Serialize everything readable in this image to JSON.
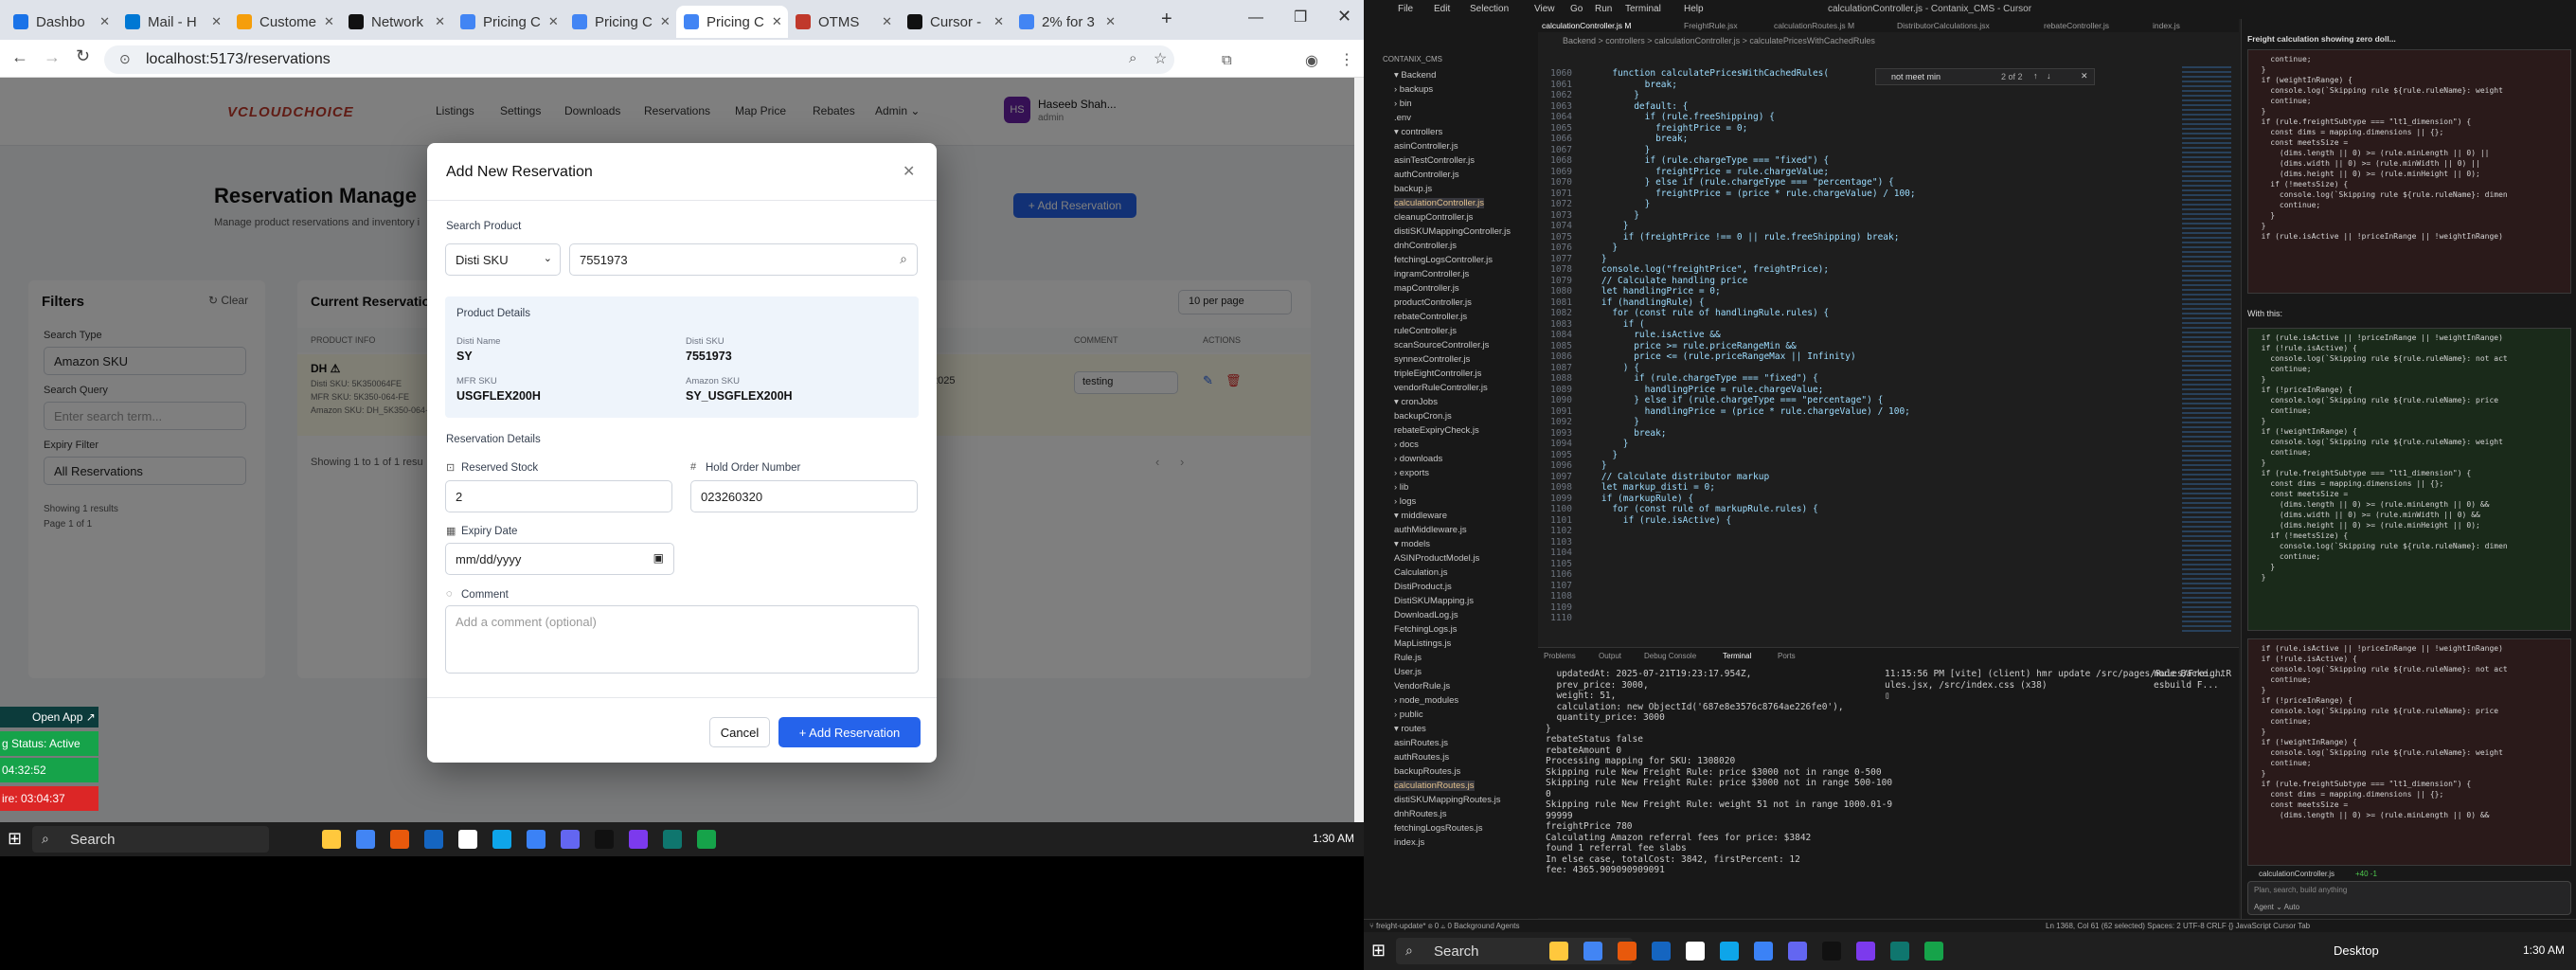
{
  "browser": {
    "tabs": [
      {
        "label": "Dashbo",
        "color": "#1a73e8",
        "active": false
      },
      {
        "label": "Mail - H",
        "color": "#0078d4",
        "active": false
      },
      {
        "label": "Custome",
        "color": "#f59e0b",
        "active": false
      },
      {
        "label": "Network",
        "color": "#111111",
        "active": false
      },
      {
        "label": "Pricing C",
        "color": "#4285f4",
        "active": false
      },
      {
        "label": "Pricing C",
        "color": "#4285f4",
        "active": false
      },
      {
        "label": "Pricing C",
        "color": "#4285f4",
        "active": true
      },
      {
        "label": "OTMS",
        "color": "#c0392b",
        "active": false
      },
      {
        "label": "Cursor -",
        "color": "#111111",
        "active": false
      },
      {
        "label": "2% for 3",
        "color": "#4285f4",
        "active": false
      }
    ],
    "url": "localhost:5173/reservations"
  },
  "nav": {
    "logo": "VCLOUDCHOICE",
    "items": [
      "Listings",
      "Settings",
      "Downloads",
      "Reservations",
      "Map Price",
      "Rebates",
      "Admin ⌄"
    ],
    "user_initials": "HS",
    "user_name": "Haseeb Shah...",
    "user_role": "admin"
  },
  "page": {
    "title": "Reservation Manage",
    "subtitle": "Manage product reservations and inventory i",
    "add_button": "+ Add Reservation",
    "filters": {
      "title": "Filters",
      "clear": "↻ Clear",
      "search_type_label": "Search Type",
      "search_type": "Amazon SKU",
      "search_query_label": "Search Query",
      "search_placeholder": "Enter search term...",
      "expiry_label": "Expiry Filter",
      "expiry": "All Reservations",
      "results": "Showing 1 results",
      "pages": "Page 1 of 1"
    },
    "table": {
      "title": "Current Reservation",
      "per_page": "10 per page",
      "col_product": "PRODUCT INFO",
      "col_comment": "COMMENT",
      "col_actions": "ACTIONS",
      "row_name": "DH ⚠",
      "row_disti": "Disti SKU: 5K350064FE",
      "row_mfr": "MFR SKU: 5K350-064-FE",
      "row_amazon": "Amazon SKU: DH_5K350-064-",
      "row_date": "2025",
      "row_comment": "testing",
      "footer": "Showing 1 to 1 of 1 resu"
    }
  },
  "modal": {
    "title": "Add New Reservation",
    "search_product_label": "Search Product",
    "search_type": "Disti SKU",
    "search_value": "7551973",
    "details_title": "Product Details",
    "disti_name_label": "Disti Name",
    "disti_name": "SY",
    "disti_sku_label": "Disti SKU",
    "disti_sku": "7551973",
    "mfr_sku_label": "MFR SKU",
    "mfr_sku": "USGFLEX200H",
    "amazon_sku_label": "Amazon SKU",
    "amazon_sku": "SY_USGFLEX200H",
    "reservation_details_title": "Reservation Details",
    "reserved_stock_label": "Reserved Stock",
    "reserved_stock": "2",
    "hold_order_label": "Hold Order Number",
    "hold_order": "023260320",
    "expiry_label": "Expiry Date",
    "expiry_placeholder": "mm/dd/yyyy",
    "comment_label": "Comment",
    "comment_placeholder": "Add a comment (optional)",
    "cancel": "Cancel",
    "submit": "+ Add Reservation"
  },
  "side_widgets": {
    "open_app": "Open App ↗",
    "status": "g Status: Active",
    "time1": "04:32:52",
    "time2": "ire: 03:04:37"
  },
  "taskbar_left": {
    "search": "Search",
    "time": "1:30 AM"
  },
  "ide": {
    "title": "calculationController.js - Contanix_CMS - Cursor",
    "menu": [
      "File",
      "Edit",
      "Selection",
      "View",
      "Go",
      "Run",
      "Terminal",
      "Help"
    ],
    "tabs": [
      "calculationController.js M",
      "FreightRule.jsx",
      "calculationRoutes.js M",
      "DistributorCalculations.jsx",
      "rebateController.js",
      "index.js"
    ],
    "breadcrumb": "Backend > controllers > calculationController.js > calculatePricesWithCachedRules",
    "find": "not meet min",
    "find_count": "2 of 2",
    "explorer_title": "CONTANIX_CMS",
    "tree": [
      "▾ Backend",
      "  › backups",
      "  › bin",
      "    .env",
      "  ▾ controllers",
      "    asinController.js",
      "    asinTestController.js",
      "    authController.js",
      "    backup.js",
      "    calculationController.js",
      "    cleanupController.js",
      "    distiSKUMappingController.js",
      "    dnhController.js",
      "    fetchingLogsController.js",
      "    ingramController.js",
      "    mapController.js",
      "    productController.js",
      "    rebateController.js",
      "    ruleController.js",
      "    scanSourceController.js",
      "    synnexController.js",
      "    tripleEightController.js",
      "    vendorRuleController.js",
      "  ▾ cronJobs",
      "    backupCron.js",
      "    rebateExpiryCheck.js",
      "  › docs",
      "  › downloads",
      "  › exports",
      "  › lib",
      "  › logs",
      "  ▾ middleware",
      "    authMiddleware.js",
      "  ▾ models",
      "    ASINProductModel.js",
      "    Calculation.js",
      "    DistiProduct.js",
      "    DistiSKUMapping.js",
      "    DownloadLog.js",
      "    FetchingLogs.js",
      "    MapListings.js",
      "    Rule.js",
      "    User.js",
      "    VendorRule.js",
      "  › node_modules",
      "  › public",
      "  ▾ routes",
      "    asinRoutes.js",
      "    authRoutes.js",
      "    backupRoutes.js",
      "    calculationRoutes.js",
      "    distiSKUMappingRoutes.js",
      "    dnhRoutes.js",
      "    fetchingLogsRoutes.js",
      "    index.js"
    ],
    "line_numbers": [
      "1060",
      "1061",
      "1062",
      "1063",
      "1064",
      "1065",
      "1066",
      "1067",
      "1068",
      "1069",
      "1070",
      "1071",
      "1072",
      "1073",
      "1074",
      "1075",
      "1076",
      "1077",
      "1078",
      "1079",
      "1080",
      "1081",
      "1082",
      "1083",
      "1084",
      "1085",
      "1086",
      "1087",
      "1088",
      "1089",
      "1090",
      "1091",
      "1092",
      "1093",
      "1094",
      "1095",
      "1096",
      "1097",
      "1098",
      "1099",
      "1100",
      "1101",
      "1102",
      "1103",
      "1104",
      "1105",
      "1106",
      "1107",
      "1108",
      "1109",
      "1110"
    ],
    "code": [
      "      function calculatePricesWithCachedRules(",
      "            break;",
      "          }",
      "          default: {",
      "            if (rule.freeShipping) {",
      "              freightPrice = 0;",
      "              break;",
      "            }",
      "            if (rule.chargeType === \"fixed\") {",
      "              freightPrice = rule.chargeValue;",
      "            } else if (rule.chargeType === \"percentage\") {",
      "              freightPrice = (price * rule.chargeValue) / 100;",
      "            }",
      "          }",
      "        }",
      "        if (freightPrice !== 0 || rule.freeShipping) break;",
      "      }",
      "    }",
      "",
      "    console.log(\"freightPrice\", freightPrice);",
      "",
      "    // Calculate handling price",
      "    let handlingPrice = 0;",
      "    if (handlingRule) {",
      "      for (const rule of handlingRule.rules) {",
      "        if (",
      "          rule.isActive &&",
      "          price >= rule.priceRangeMin &&",
      "          price <= (rule.priceRangeMax || Infinity)",
      "        ) {",
      "          if (rule.chargeType === \"fixed\") {",
      "            handlingPrice = rule.chargeValue;",
      "          } else if (rule.chargeType === \"percentage\") {",
      "            handlingPrice = (price * rule.chargeValue) / 100;",
      "          }",
      "",
      "          break;",
      "        }",
      "      }",
      "    }",
      "",
      "    // Calculate distributor markup",
      "    let markup_disti = 0;",
      "    if (markupRule) {",
      "      for (const rule of markupRule.rules) {",
      "        if (rule.isActive) {"
    ],
    "panel_tabs": [
      "Problems",
      "Output",
      "Debug Console",
      "Terminal",
      "Ports"
    ],
    "terminal_left": [
      "  updatedAt: 2025-07-21T19:23:17.954Z,",
      "  prev_price: 3000,",
      "  weight: 51,",
      "  calculation: new ObjectId('687e8e3576c8764ae226fe0'),",
      "  quantity_price: 3000",
      "}",
      "rebateStatus false",
      "rebateAmount 0",
      "",
      "Processing mapping for SKU: 1308020",
      "Skipping rule New Freight Rule: price $3000 not in range 0-500",
      "Skipping rule New Freight Rule: price $3000 not in range 500-100",
      "0",
      "Skipping rule New Freight Rule: weight 51 not in range 1000.01-9",
      "99999",
      "freightPrice 780",
      "",
      "Calculating Amazon referral fees for price: $3842",
      "found 1 referral fee slabs",
      "In else case, totalCost: 3842, firstPercent: 12",
      "fee: 4365.909090909091"
    ],
    "terminal_right": [
      "11:15:56 PM [vite] (client) hmr update /src/pages/Rules/FreightR",
      "ules.jsx, /src/index.css (x38)",
      "▯"
    ],
    "terminal_sessions": [
      "node Backe...",
      "esbuild F..."
    ],
    "chat_title": "Freight calculation showing zero doll...",
    "chat_with_this": "With this:",
    "chat_code_top": [
      "    continue;",
      "  }",
      "",
      "  if (weightInRange) {",
      "    console.log(`Skipping rule ${rule.ruleName}: weight",
      "    continue;",
      "  }",
      "",
      "  if (rule.freightSubtype === \"lt1_dimension\") {",
      "    const dims = mapping.dimensions || {};",
      "    const meetsSize =",
      "      (dims.length || 0) >= (rule.minLength || 0) ||",
      "      (dims.width || 0) >= (rule.minWidth || 0) ||",
      "      (dims.height || 0) >= (rule.minHeight || 0);",
      "    if (!meetsSize) {",
      "      console.log(`Skipping rule ${rule.ruleName}: dimen",
      "      continue;",
      "    }",
      "  }",
      "  if (rule.isActive || !priceInRange || !weightInRange)"
    ],
    "chat_code_bottom": [
      "  if (rule.isActive || !priceInRange || !weightInRange)",
      "  if (!rule.isActive) {",
      "    console.log(`Skipping rule ${rule.ruleName}: not act",
      "    continue;",
      "  }",
      "",
      "  if (!priceInRange) {",
      "    console.log(`Skipping rule ${rule.ruleName}: price",
      "    continue;",
      "  }",
      "",
      "  if (!weightInRange) {",
      "    console.log(`Skipping rule ${rule.ruleName}: weight",
      "    continue;",
      "  }",
      "",
      "  if (rule.freightSubtype === \"lt1_dimension\") {",
      "    const dims = mapping.dimensions || {};",
      "    const meetsSize =",
      "      (dims.length || 0) >= (rule.minLength || 0) &&",
      "      (dims.width || 0) >= (rule.minWidth || 0) &&",
      "      (dims.height || 0) >= (rule.minHeight || 0);",
      "    if (!meetsSize) {",
      "      console.log(`Skipping rule ${rule.ruleName}: dimen",
      "      continue;",
      "    }",
      "  }"
    ],
    "chat_code_third": [
      "  if (rule.isActive || !priceInRange || !weightInRange)",
      "  if (!rule.isActive) {",
      "    console.log(`Skipping rule ${rule.ruleName}: not act",
      "    continue;",
      "  }",
      "",
      "  if (!priceInRange) {",
      "    console.log(`Skipping rule ${rule.ruleName}: price",
      "    continue;",
      "  }",
      "",
      "  if (!weightInRange) {",
      "    console.log(`Skipping rule ${rule.ruleName}: weight",
      "    continue;",
      "  }",
      "",
      "  if (rule.freightSubtype === \"lt1_dimension\") {",
      "    const dims = mapping.dimensions || {};",
      "    const meetsSize =",
      "      (dims.length || 0) >= (rule.minLength || 0) &&"
    ],
    "chat_file": "calculationController.js",
    "chat_file_stat": "+40 -1",
    "chat_input_placeholder": "Plan, search, build anything",
    "chat_mode": "Agent ⌄  Auto",
    "statusbar": "Ln 1368, Col 61 (62 selected)   Spaces: 2   UTF-8   CRLF   {} JavaScript   Cursor Tab",
    "statusbar_left": "⑂ freight-update*   ⊗ 0 ⚠ 0   Background Agents",
    "taskbar_search": "Search",
    "taskbar_desktop": "Desktop",
    "taskbar_time": "1:30 AM"
  }
}
